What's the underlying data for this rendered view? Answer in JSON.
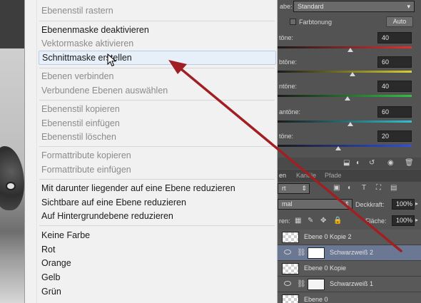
{
  "context_menu": {
    "items": [
      {
        "label": "Ebenenstil rastern",
        "disabled": true
      },
      {
        "label": "Ebenenmaske deaktivieren",
        "disabled": false
      },
      {
        "label": "Vektormaske aktivieren",
        "disabled": true
      },
      {
        "label": "Schnittmaske erstellen",
        "disabled": false,
        "highlighted": true
      },
      {
        "label": "Ebenen verbinden",
        "disabled": true
      },
      {
        "label": "Verbundene Ebenen auswählen",
        "disabled": true
      },
      {
        "label": "Ebenenstil kopieren",
        "disabled": true
      },
      {
        "label": "Ebenenstil einfügen",
        "disabled": true
      },
      {
        "label": "Ebenenstil löschen",
        "disabled": true
      },
      {
        "label": "Formattribute kopieren",
        "disabled": true
      },
      {
        "label": "Formattribute einfügen",
        "disabled": true
      },
      {
        "label": "Mit darunter liegender auf eine Ebene reduzieren",
        "disabled": false
      },
      {
        "label": "Sichtbare auf eine Ebene reduzieren",
        "disabled": false
      },
      {
        "label": "Auf Hintergrundebene reduzieren",
        "disabled": false
      },
      {
        "label": "Keine Farbe",
        "disabled": false
      },
      {
        "label": "Rot",
        "disabled": false
      },
      {
        "label": "Orange",
        "disabled": false
      },
      {
        "label": "Gelb",
        "disabled": false
      },
      {
        "label": "Grün",
        "disabled": false
      }
    ]
  },
  "properties": {
    "preset_label": "abe:",
    "preset_value": "Standard",
    "tint_label": "Farbtonung",
    "auto_label": "Auto",
    "sliders": [
      {
        "label": "töne:",
        "value": "40",
        "color": "#e03030",
        "level": 0.54
      },
      {
        "label": "btöne:",
        "value": "60",
        "color": "#d8d030",
        "level": 0.56
      },
      {
        "label": "ntöne:",
        "value": "40",
        "color": "#30c040",
        "level": 0.52
      },
      {
        "label": "antöne:",
        "value": "60",
        "color": "#30c0d0",
        "level": 0.54
      },
      {
        "label": "töne:",
        "value": "20",
        "color": "#3050e0",
        "level": 0.45
      }
    ]
  },
  "layers_panel": {
    "tabs": [
      "en",
      "Kanäle",
      "Pfade"
    ],
    "kind_value": "rt",
    "blend_value": "mal",
    "opacity_label": "Deckkraft:",
    "opacity_value": "100%",
    "lock_label": "ren:",
    "fill_label": "Fläche:",
    "fill_value": "100%",
    "layers": [
      {
        "name": "Ebene 0 Kopie 2",
        "selected": false
      },
      {
        "name": "Schwarzweiß 2",
        "selected": true
      },
      {
        "name": "Ebene 0 Kopie",
        "selected": false
      },
      {
        "name": "Schwarzweiß 1",
        "selected": false
      },
      {
        "name": "Ebene 0",
        "selected": false
      }
    ]
  }
}
